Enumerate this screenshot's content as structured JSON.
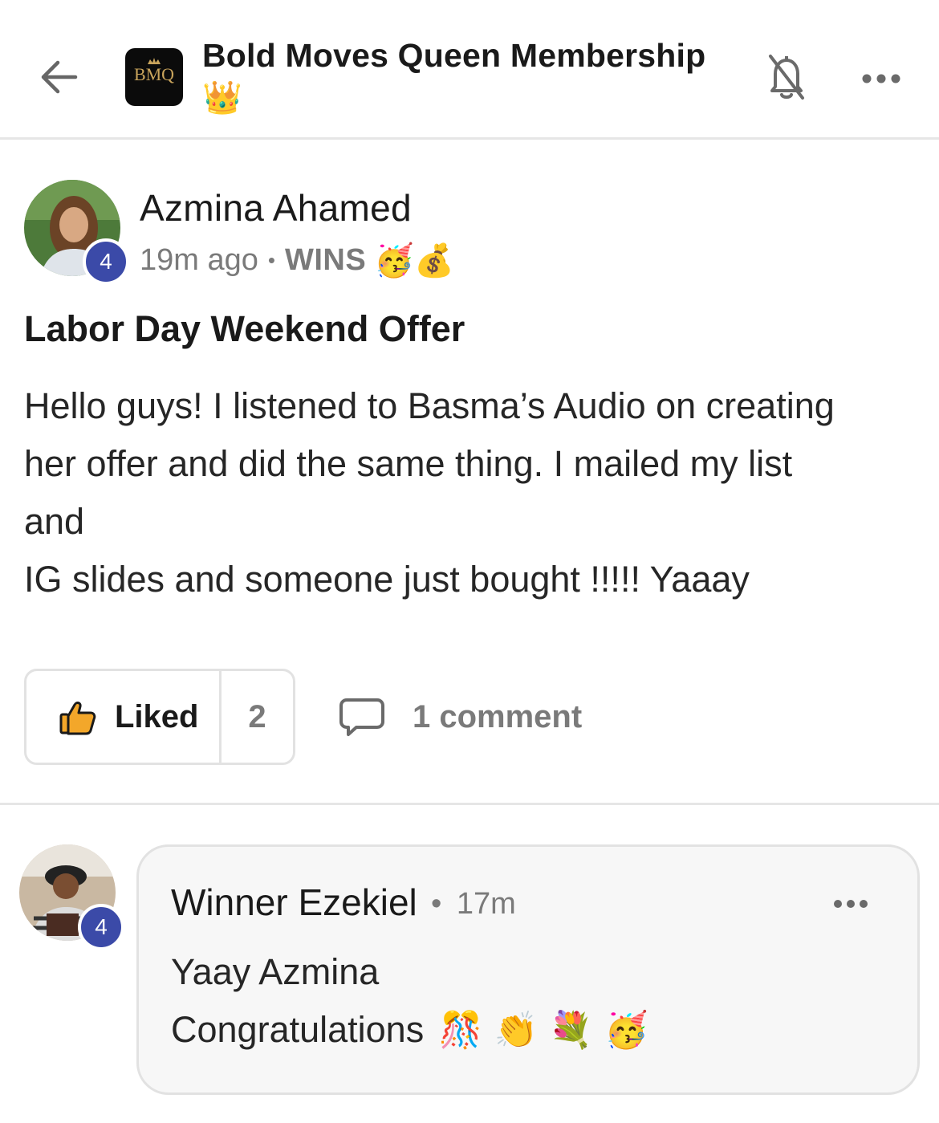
{
  "header": {
    "title": "Bold Moves Queen Membership",
    "title_emoji": "👑",
    "logo_text": "BMQ",
    "icons": [
      "back-arrow-icon",
      "bell-off-icon",
      "more-horizontal-icon"
    ]
  },
  "post": {
    "author": "Azmina Ahamed",
    "level_badge": "4",
    "time": "19m ago",
    "separator": "•",
    "category": "WINS",
    "category_emojis": "🥳💰",
    "title": "Labor Day Weekend Offer",
    "body_lines": [
      "Hello guys! I listened to Basma’s Audio on creating",
      "her offer and did the same thing. I mailed my list",
      "and",
      "IG slides and someone just bought !!!!! Yaaay"
    ],
    "like_label": "Liked",
    "like_count": "2",
    "comment_label": "1 comment"
  },
  "comment": {
    "author": "Winner Ezekiel",
    "level_badge": "4",
    "separator": "•",
    "time": "17m",
    "line1": "Yaay Azmina",
    "line2": "Congratulations",
    "line2_emojis": "🎊👏💐🥳"
  },
  "colors": {
    "badge": "#3b4aa8",
    "divider": "#e6e6e6",
    "muted_text": "#7a7a7a",
    "like_icon": "#f3a72a",
    "logo_bg": "#0b0b0b",
    "logo_gold": "#c9a45c"
  }
}
